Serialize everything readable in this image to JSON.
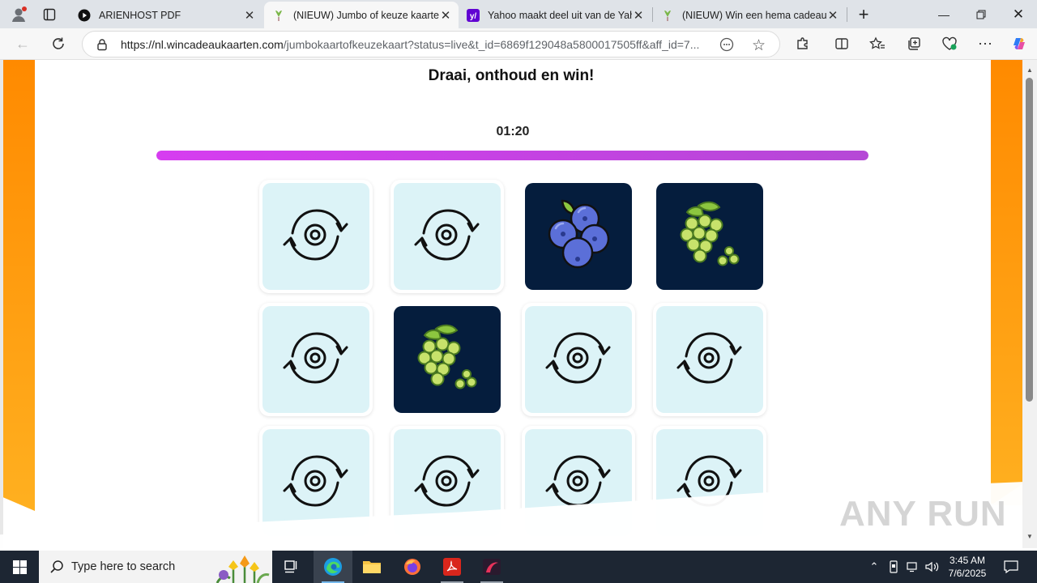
{
  "browser": {
    "tabs": [
      {
        "title": "ARIENHOST PDF",
        "icon": "play-circle-icon",
        "active": false
      },
      {
        "title": "(NIEUW) Jumbo of keuze kaarten",
        "icon": "heart-flag-icon",
        "active": true
      },
      {
        "title": "Yahoo maakt deel uit van de Yahoo",
        "icon": "yahoo-icon",
        "active": false
      },
      {
        "title": "(NIEUW) Win een hema cadeauka",
        "icon": "heart-flag-icon",
        "active": false
      }
    ],
    "url_host": "https://nl.wincadeaukaarten.com",
    "url_path": "/jumbokaartofkeuzekaart?status=live&t_id=6869f129048a5800017505ff&aff_id=7..."
  },
  "page": {
    "title": "Draai, onthoud en win!",
    "timer": "01:20",
    "progress_fraction": 1.0
  },
  "cards": [
    {
      "state": "hidden",
      "icon": "flip-card-icon"
    },
    {
      "state": "hidden",
      "icon": "flip-card-icon"
    },
    {
      "state": "open",
      "icon": "blueberries-icon"
    },
    {
      "state": "open",
      "icon": "grapes-icon"
    },
    {
      "state": "hidden",
      "icon": "flip-card-icon"
    },
    {
      "state": "open",
      "icon": "grapes-icon"
    },
    {
      "state": "hidden",
      "icon": "flip-card-icon"
    },
    {
      "state": "hidden",
      "icon": "flip-card-icon"
    },
    {
      "state": "hidden",
      "icon": "flip-card-icon"
    },
    {
      "state": "hidden",
      "icon": "flip-card-icon"
    },
    {
      "state": "hidden",
      "icon": "flip-card-icon"
    },
    {
      "state": "hidden",
      "icon": "flip-card-icon"
    }
  ],
  "watermark": "ANY RUN",
  "taskbar": {
    "search_placeholder": "Type here to search",
    "time": "3:45 AM",
    "date": "7/6/2025"
  },
  "colors": {
    "accent_orange": "#ff8a00",
    "progress_purple": "#d63df0",
    "card_back": "#dcf3f7",
    "card_open": "#051d3d"
  }
}
